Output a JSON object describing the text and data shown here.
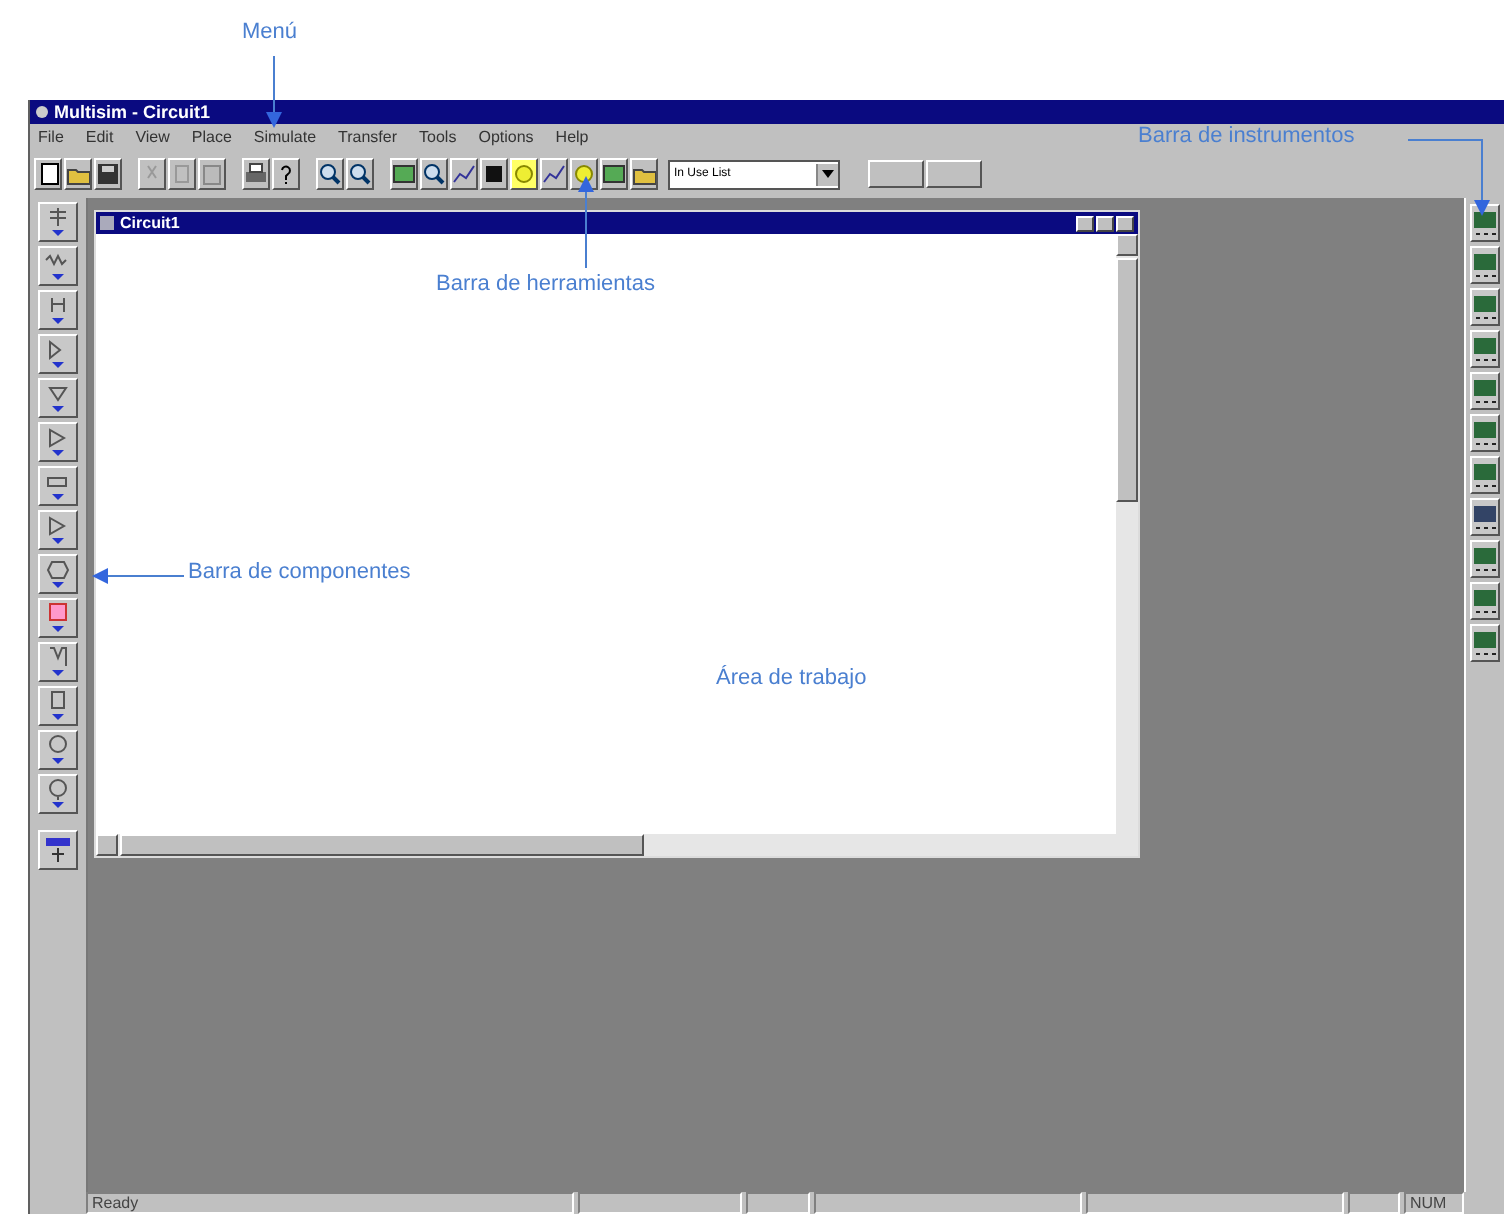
{
  "annotations": {
    "menu": "Menú",
    "toolbar": "Barra de herramientas",
    "components": "Barra de componentes",
    "workspace": "Área de trabajo",
    "instruments": "Barra de instrumentos"
  },
  "window": {
    "title": "Multisim - Circuit1"
  },
  "menu": [
    "File",
    "Edit",
    "View",
    "Place",
    "Simulate",
    "Transfer",
    "Tools",
    "Options",
    "Help"
  ],
  "toolbar": {
    "in_use_list": "In Use List"
  },
  "child_window": {
    "title": "Circuit1"
  },
  "status_bar": {
    "message": "Ready",
    "num": "NUM"
  }
}
